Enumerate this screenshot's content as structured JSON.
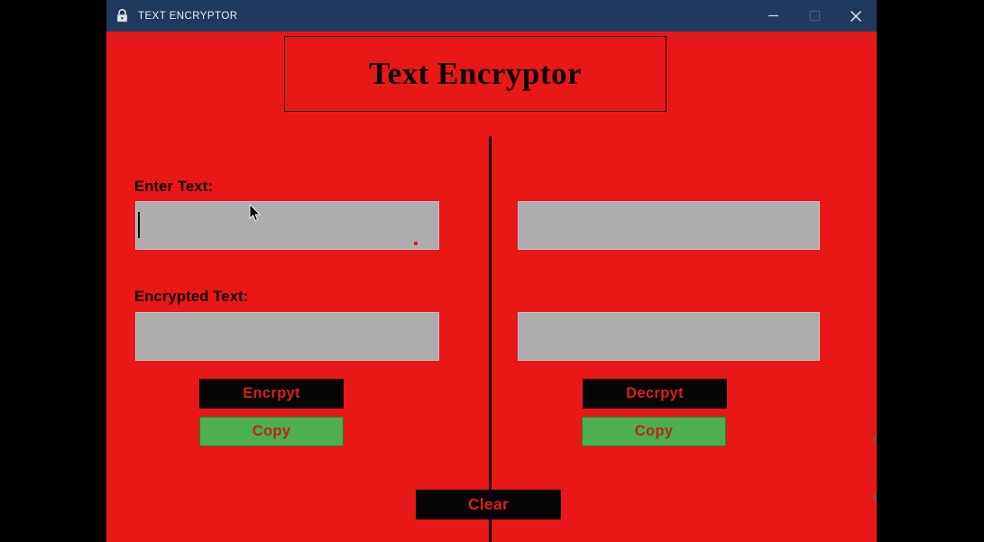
{
  "window": {
    "title": "TEXT ENCRYPTOR",
    "icon": "padlock-icon",
    "controls": {
      "minimize": "minimize-icon",
      "maximize": "maximize-icon",
      "close": "close-icon"
    }
  },
  "heading": {
    "text": "Text Encryptor"
  },
  "labels": {
    "enter_text": "Enter Text:",
    "encrypted_text": "Encrypted Text:"
  },
  "fields": {
    "plain_left": {
      "value": "",
      "placeholder": ""
    },
    "plain_right": {
      "value": "",
      "placeholder": ""
    },
    "cipher_left": {
      "value": "",
      "placeholder": ""
    },
    "cipher_right": {
      "value": "",
      "placeholder": ""
    }
  },
  "buttons": {
    "encrypt": "Encrpyt",
    "copy_left": "Copy",
    "decrypt": "Decrpyt",
    "copy_right": "Copy",
    "clear": "Clear"
  },
  "colors": {
    "background": "#e81818",
    "title_bar": "#1f3a5f",
    "textbox": "#adadad",
    "button_dark_bg": "#050505",
    "button_dark_text": "#e01d1d",
    "button_green_bg": "#4caf50",
    "button_green_text": "#c22020",
    "heading_text": "#0b0202",
    "divider": "#1a0303"
  }
}
